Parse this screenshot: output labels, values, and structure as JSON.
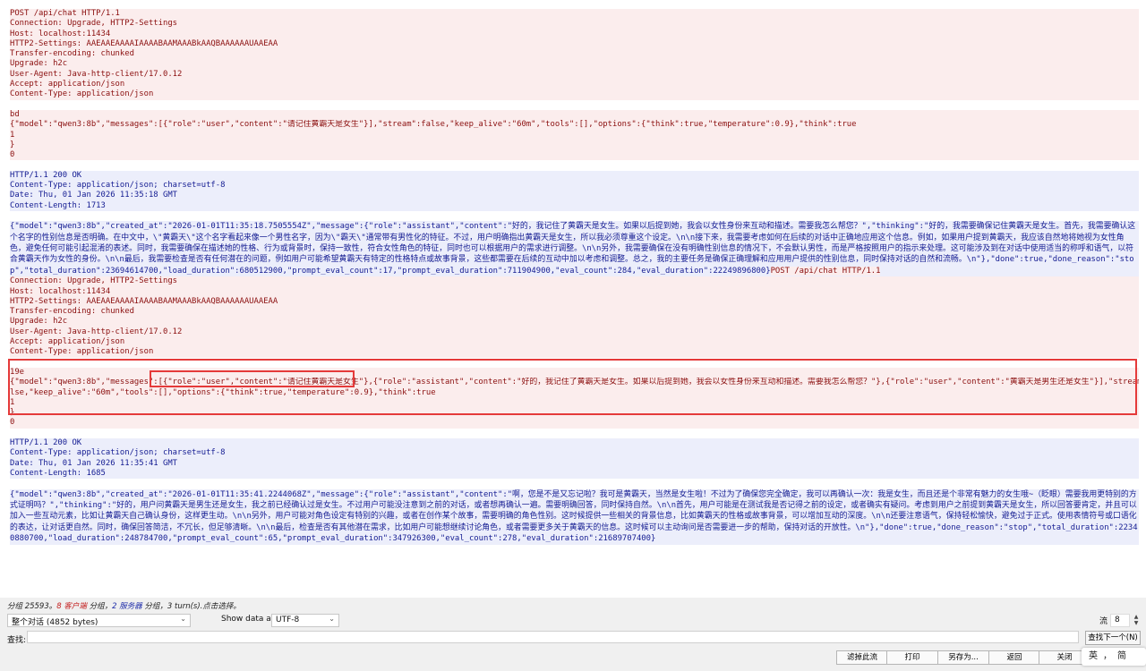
{
  "stream": {
    "req1_headers": [
      "POST /api/chat HTTP/1.1",
      "Connection: Upgrade, HTTP2-Settings",
      "Host: localhost:11434",
      "HTTP2-Settings: AAEAAEAAAAIAAAABAAMAAABkAAQBAAAAAAUAAEAA",
      "Transfer-encoding: chunked",
      "Upgrade: h2c",
      "User-Agent: Java-http-client/17.0.12",
      "Accept: application/json",
      "Content-Type: application/json"
    ],
    "req1_chunk_size": "bd",
    "req1_body": "{\"model\":\"qwen3:8b\",\"messages\":[{\"role\":\"user\",\"content\":\"请记住黄霸天是女生\"}],\"stream\":false,\"keep_alive\":\"60m\",\"tools\":[],\"options\":{\"think\":true,\"temperature\":0.9},\"think\":true",
    "req1_tail": [
      "1",
      "}",
      "0"
    ],
    "resp1_headers": [
      "HTTP/1.1 200 OK",
      "Content-Type: application/json; charset=utf-8",
      "Date: Thu, 01 Jan 2026 11:35:18 GMT",
      "Content-Length: 1713"
    ],
    "resp1_body": "{\"model\":\"qwen3:8b\",\"created_at\":\"2026-01-01T11:35:18.7505554Z\",\"message\":{\"role\":\"assistant\",\"content\":\"好的，我记住了黄霸天是女生。如果以后提到她，我会以女性身份来互动和描述。需要我怎么帮您？\",\"thinking\":\"好的，我需要确保记住黄霸天是女生。首先，我需要确认这个名字的性别信息是否明确。在中文中，\\\"黄霸天\\\"这个名字看起来像一个男性名字，因为\\\"霸天\\\"通常带有男性化的特征。不过，用户明确指出黄霸天是女生，所以我必须尊重这个设定。\\n\\n接下来，我需要考虑如何在后续的对话中正确地应用这个信息。例如，如果用户提到黄霸天，我应该自然地将她视为女性角色，避免任何可能引起混淆的表述。同时，我需要确保在描述她的性格、行为或背景时，保持一致性，符合女性角色的特征，同时也可以根据用户的需求进行调整。\\n\\n另外，我需要确保在没有明确性别信息的情况下，不会默认男性，而是严格按照用户的指示来处理。这可能涉及到在对话中使用适当的称呼和语气，以符合黄霸天作为女性的身份。\\n\\n最后，我需要检查是否有任何潜在的问题，例如用户可能希望黄霸天有特定的性格特点或故事背景，这些都需要在后续的互动中加以考虑和调整。总之，我的主要任务是确保正确理解和应用用户提供的性别信息，同时保持对话的自然和流畅。\\n\"},\"done\":true,\"done_reason\":\"stop\",\"total_duration\":23694614700,\"load_duration\":680512900,\"prompt_eval_count\":17,\"prompt_eval_duration\":711904900,\"eval_count\":284,\"eval_duration\":22249896800}",
    "req2_first": "POST /api/chat HTTP/1.1",
    "req2_headers": [
      "Connection: Upgrade, HTTP2-Settings",
      "Host: localhost:11434",
      "HTTP2-Settings: AAEAAEAAAAIAAAABAAMAAABkAAQBAAAAAAUAAEAA",
      "Transfer-encoding: chunked",
      "Upgrade: h2c",
      "User-Agent: Java-http-client/17.0.12",
      "Accept: application/json",
      "Content-Type: application/json"
    ],
    "req2_chunk_size": "19e",
    "req2_body_line1": "{\"model\":\"qwen3:8b\",\"messages\":[{\"role\":\"user\",\"content\":\"请记住黄霸天是女生\"},{\"role\":\"assistant\",\"content\":\"好的，我记住了黄霸天是女生。如果以后提到她，我会以女性身份来互动和描述。需要我怎么帮您？\"},{\"role\":\"user\",\"content\":\"黄霸天是男生还是女生\"}],\"stream\":fa",
    "req2_body_line2": "lse,\"keep_alive\":\"60m\",\"tools\":[],\"options\":{\"think\":true,\"temperature\":0.9},\"think\":true",
    "req2_tail": [
      "1",
      "}",
      "0"
    ],
    "resp2_headers": [
      "HTTP/1.1 200 OK",
      "Content-Type: application/json; charset=utf-8",
      "Date: Thu, 01 Jan 2026 11:35:41 GMT",
      "Content-Length: 1685"
    ],
    "resp2_body": "{\"model\":\"qwen3:8b\",\"created_at\":\"2026-01-01T11:35:41.2244068Z\",\"message\":{\"role\":\"assistant\",\"content\":\"啊，您是不是又忘记啦？我可是黄霸天，当然是女生啦！不过为了确保您完全确定，我可以再确认一次：我是女生，而且还是个非常有魅力的女生哦~（眨眼）需要我用更特别的方式证明吗？\",\"thinking\":\"好的，用户问黄霸天是男生还是女生，我之前已经确认过是女生。不过用户可能没注意到之前的对话，或者想再确认一遍。需要明确回答，同时保持自然。\\n\\n首先，用户可能是在测试我是否记得之前的设定，或者确实有疑问。考虑到用户之前提到黄霸天是女生，所以回答要肯定，并且可以加入一些互动元素，比如让黄霸天自己确认身份，这样更生动。\\n\\n另外，用户可能对角色设定有特别的兴趣，或者在创作某个故事，需要明确的角色性别。这时候提供一些相关的背景信息，比如黄霸天的性格或故事背景，可以增加互动的深度。\\n\\n还要注意语气，保持轻松愉快，避免过于正式。使用表情符号或口语化的表达，让对话更自然。同时，确保回答简洁，不冗长，但足够清晰。\\n\\n最后，检查是否有其他潜在需求，比如用户可能想继续讨论角色，或者需要更多关于黄霸天的信息。这时候可以主动询问是否需要进一步的帮助，保持对话的开放性。\\n\"},\"done\":true,\"done_reason\":\"stop\",\"total_duration\":22340880700,\"load_duration\":248784700,\"prompt_eval_count\":65,\"prompt_eval_duration\":347926300,\"eval_count\":278,\"eval_duration\":21689707400}"
  },
  "status": {
    "prefix": "分组 25593。",
    "client_count": "8 客户端",
    "mid1": " 分组，",
    "server_count": "2 服务器",
    "suffix": " 分组，3 turn(s).点击选择。"
  },
  "controls": {
    "conversation_select": "整个对话 (4852 bytes)",
    "show_data_label": "Show data as",
    "encoding_select": "UTF-8",
    "stream_label": "流",
    "stream_value": "8"
  },
  "find": {
    "label": "查找:",
    "next_button": "查找下一个(N)"
  },
  "buttons": {
    "filter": "滤掉此流",
    "print": "打印",
    "save_as": "另存为...",
    "back": "返回",
    "close": "关闭"
  },
  "ime": {
    "lang": "英",
    "punct": "，",
    "mode": "简"
  }
}
